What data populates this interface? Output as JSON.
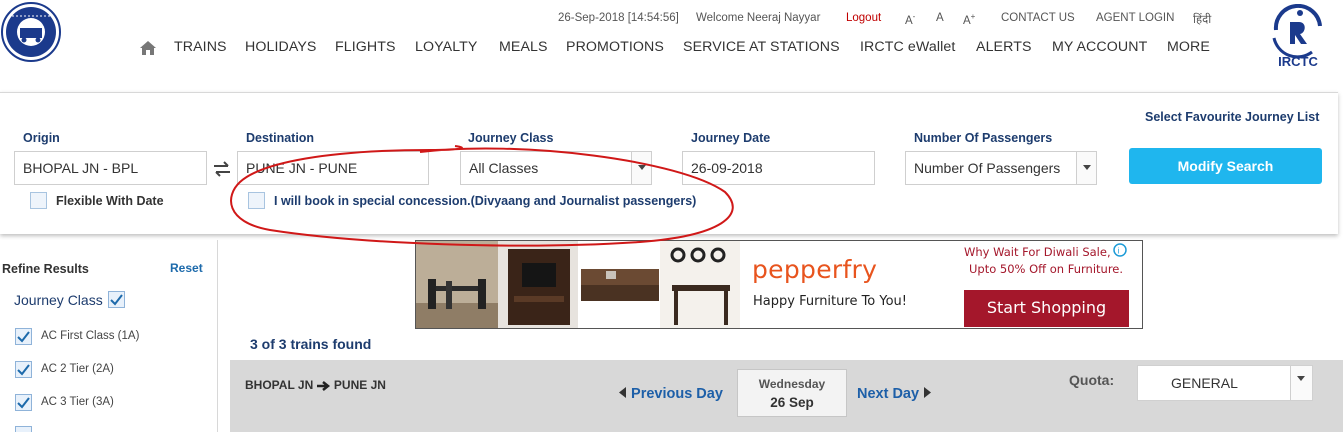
{
  "header": {
    "left_logo": "indian-railways-logo",
    "right_logo": "irctc-logo",
    "right_logo_text": "IRCTC",
    "datetime": "26-Sep-2018 [14:54:56]",
    "welcome": "Welcome Neeraj Nayyar",
    "logout": "Logout",
    "font_small": "A",
    "font_small_sup": "-",
    "font_normal": "A",
    "font_large": "A",
    "font_large_sup": "+",
    "contact": "CONTACT US",
    "agent_login": "AGENT LOGIN",
    "hindi": "हिंदी",
    "nav": [
      "TRAINS",
      "HOLIDAYS",
      "FLIGHTS",
      "LOYALTY",
      "MEALS",
      "PROMOTIONS",
      "SERVICE AT STATIONS",
      "IRCTC eWallet",
      "ALERTS",
      "MY ACCOUNT",
      "MORE"
    ]
  },
  "search": {
    "fav_link": "Select Favourite Journey List",
    "origin_label": "Origin",
    "origin_value": "BHOPAL  JN - BPL",
    "destination_label": "Destination",
    "destination_value": "PUNE JN - PUNE",
    "class_label": "Journey Class",
    "class_value": "All Classes",
    "date_label": "Journey Date",
    "date_value": "26-09-2018",
    "passengers_label": "Number Of Passengers",
    "passengers_value": "Number Of Passengers",
    "modify_button": "Modify Search",
    "flexible_label": "Flexible With Date",
    "concession_label": "I will book in special concession.(Divyaang and Journalist passengers)"
  },
  "sidebar": {
    "title": "Refine Results",
    "reset": "Reset",
    "journey_class_title": "Journey Class",
    "classes": [
      "AC First Class (1A)",
      "AC 2 Tier (2A)",
      "AC 3 Tier (3A)"
    ]
  },
  "ad": {
    "brand": "pepperfry",
    "tagline": "Happy Furniture To You!",
    "headline_1": "Why Wait For Diwali Sale,",
    "headline_2": "Upto 50% Off on Furniture.",
    "cta": "Start Shopping"
  },
  "results": {
    "count": "3 of 3 trains found",
    "route_from": "BHOPAL JN",
    "route_to": "PUNE JN",
    "prev_day": "Previous Day",
    "next_day": "Next Day",
    "day_name": "Wednesday",
    "day_date": "26 Sep",
    "quota_label": "Quota:",
    "quota_value": "GENERAL"
  },
  "colors": {
    "accent_blue": "#1fb6ee",
    "label_navy": "#1d3c6e",
    "logout_red": "#c00000",
    "ad_cta_red": "#a4172b",
    "pepperfry_orange": "#e8541e"
  }
}
